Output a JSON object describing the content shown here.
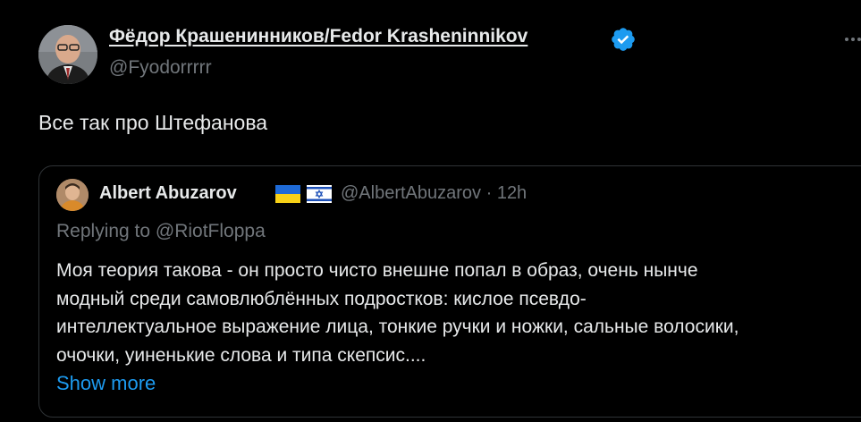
{
  "author": {
    "name": "Фёдор Крашенинников/Fedor Krasheninnikov",
    "handle": "@Fyodorrrrr",
    "verified": true
  },
  "tweet": {
    "text": "Все так про Штефанова"
  },
  "quoted": {
    "name": "Albert Abuzarov",
    "flags": [
      "ukraine-flag",
      "israel-flag"
    ],
    "handle_time": "@AlbertAbuzarov · 12h",
    "replying": "Replying to @RiotFloppa",
    "lines": [
      "Моя теория такова - он просто чисто внешне попал в образ, очень нынче",
      "модный среди самовлюблённых подростков: кислое псевдо-",
      "интеллектуальное выражение лица, тонкие ручки и ножки, сальные волосики,",
      "очочки, уиненькие слова и типа скепсис...."
    ],
    "show_more": "Show more"
  },
  "colors": {
    "background": "#000000",
    "text": "#e7e9ea",
    "secondary": "#71767b",
    "link": "#1d9bf0",
    "border": "#2f3336"
  }
}
